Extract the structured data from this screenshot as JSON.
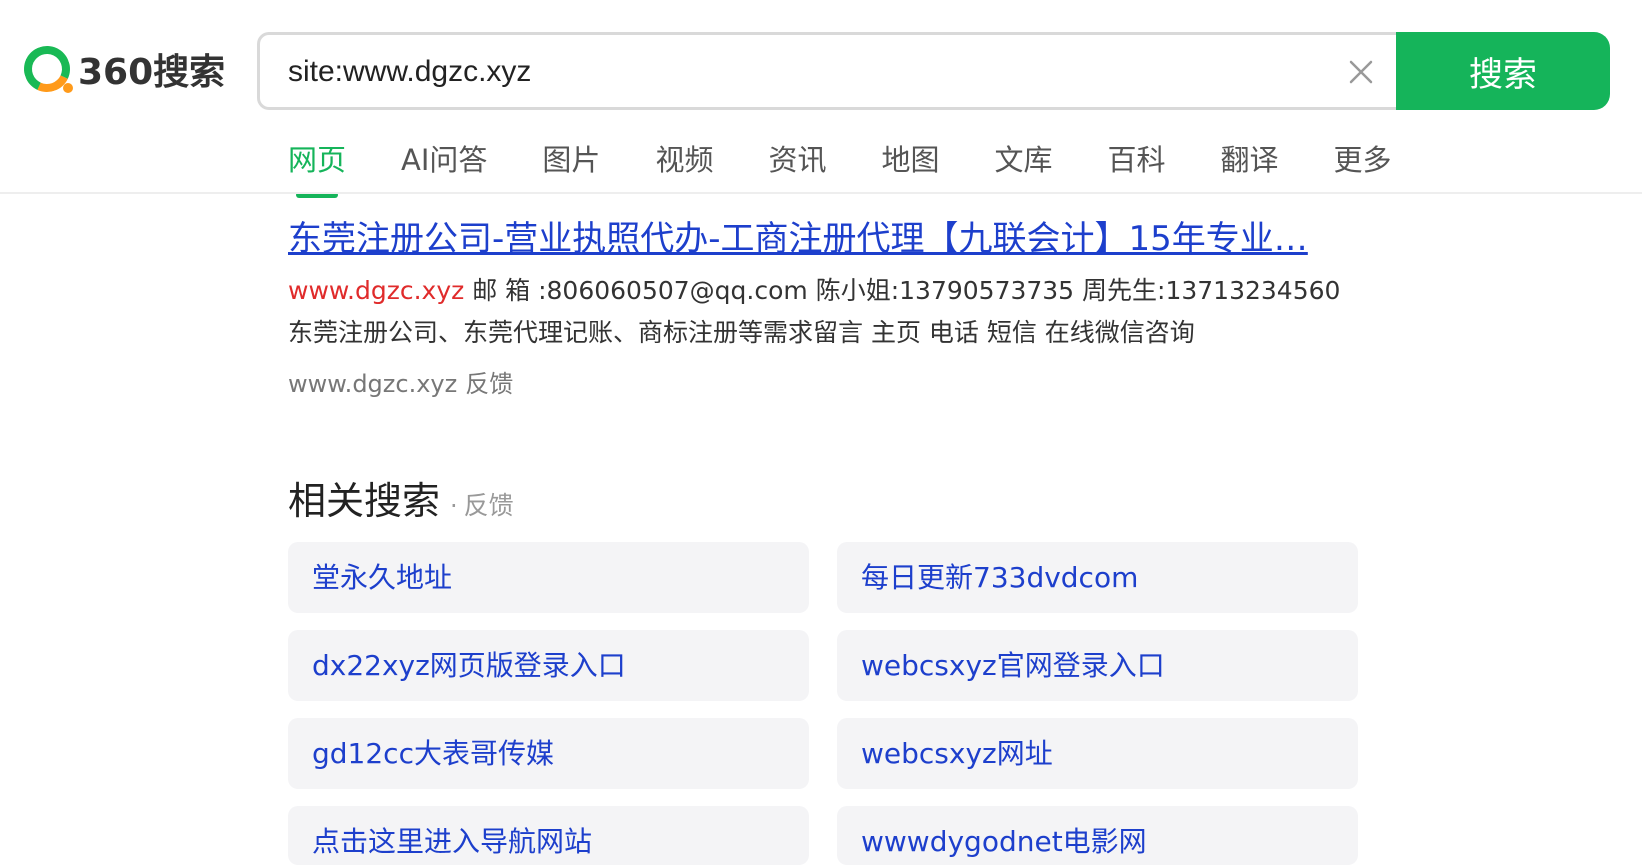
{
  "logo": {
    "text": "360搜索"
  },
  "search": {
    "query": "site:www.dgzc.xyz",
    "button_label": "搜索"
  },
  "nav": {
    "items": [
      {
        "label": "网页",
        "active": true
      },
      {
        "label": "AI问答"
      },
      {
        "label": "图片"
      },
      {
        "label": "视频"
      },
      {
        "label": "资讯"
      },
      {
        "label": "地图"
      },
      {
        "label": "文库"
      },
      {
        "label": "百科"
      },
      {
        "label": "翻译"
      },
      {
        "label": "更多"
      }
    ]
  },
  "result": {
    "title": "东莞注册公司-营业执照代办-工商注册代理【九联会计】15年专业…",
    "snippet_url": "www.dgzc.xyz",
    "snippet_text": " 邮 箱 :806060507@qq.com 陈小姐:13790573735 周先生:13713234560 东莞注册公司、东莞代理记账、商标注册等需求留言 主页 电话 短信 在线微信咨询",
    "display_url": "www.dgzc.xyz",
    "feedback": "反馈"
  },
  "related": {
    "title": "相关搜索",
    "dot": "·",
    "feedback": "反馈",
    "items": [
      "堂永久地址",
      "每日更新733dvdcom",
      "dx22xyz网页版登录入口",
      "webcsxyz官网登录入口",
      "gd12cc大表哥传媒",
      "webcsxyz网址",
      "点击这里进入导航网站",
      "wwwdygodnet电影网"
    ]
  }
}
